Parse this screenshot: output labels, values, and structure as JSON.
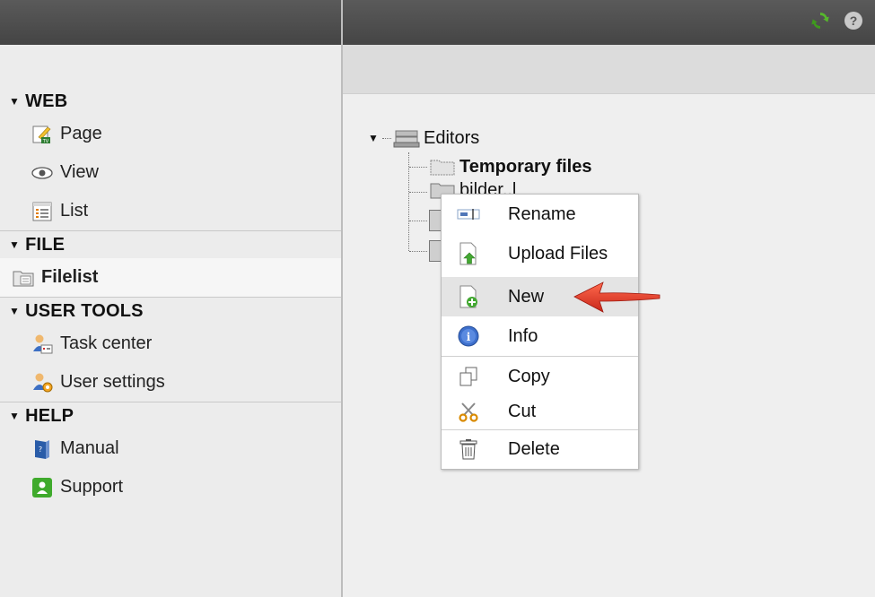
{
  "sidebar": {
    "groups": [
      {
        "title": "WEB",
        "items": [
          {
            "label": "Page",
            "icon": "page-icon"
          },
          {
            "label": "View",
            "icon": "eye-icon"
          },
          {
            "label": "List",
            "icon": "list-icon"
          }
        ]
      },
      {
        "title": "FILE",
        "items": [
          {
            "label": "Filelist",
            "icon": "filelist-icon",
            "active": true
          }
        ]
      },
      {
        "title": "USER TOOLS",
        "items": [
          {
            "label": "Task center",
            "icon": "task-center-icon"
          },
          {
            "label": "User settings",
            "icon": "user-settings-icon"
          }
        ]
      },
      {
        "title": "HELP",
        "items": [
          {
            "label": "Manual",
            "icon": "manual-icon"
          },
          {
            "label": "Support",
            "icon": "support-icon"
          }
        ]
      }
    ]
  },
  "tree": {
    "root": "Editors",
    "nodes": [
      {
        "label": "Temporary files",
        "bold": true
      },
      {
        "label": "bilder..l",
        "bold": false
      }
    ]
  },
  "context_menu": {
    "items": [
      {
        "label": "Rename",
        "icon": "rename-icon"
      },
      {
        "label": "Upload Files",
        "icon": "upload-icon"
      },
      {
        "label": "New",
        "icon": "new-file-icon",
        "hover": true
      },
      {
        "label": "Info",
        "icon": "info-icon"
      },
      {
        "label": "Copy",
        "icon": "copy-icon"
      },
      {
        "label": "Cut",
        "icon": "cut-icon"
      },
      {
        "label": "Delete",
        "icon": "delete-icon"
      }
    ]
  },
  "colors": {
    "topbar": "#4a4a4a",
    "arrow": "#e8392a",
    "refresh": "#4caf28"
  }
}
